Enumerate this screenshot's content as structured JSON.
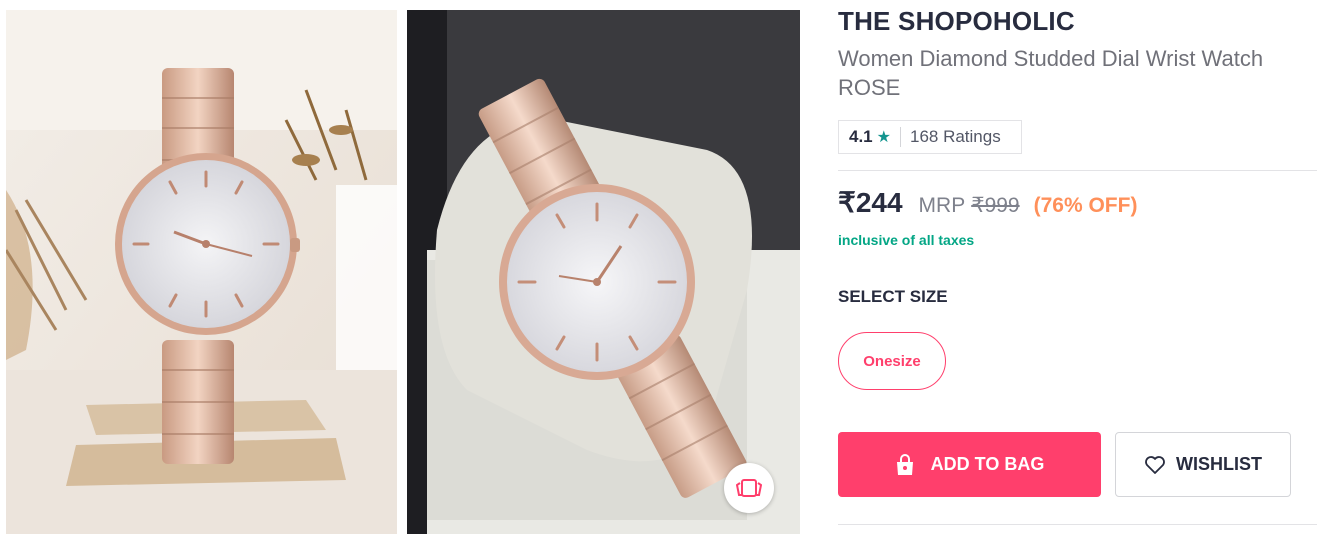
{
  "product": {
    "brand": "THE SHOPOHOLIC",
    "name": "Women Diamond Studded Dial Wrist Watch ROSE",
    "images": [
      "rose-gold-watch-front",
      "rose-gold-watch-in-box"
    ]
  },
  "rating": {
    "value": "4.1",
    "star_icon": "star-icon",
    "count": "168 Ratings"
  },
  "price": {
    "current": "₹244",
    "mrp_label": "MRP",
    "mrp": "₹999",
    "discount": "(76% OFF)",
    "tax_note": "inclusive of all taxes"
  },
  "size": {
    "heading": "SELECT SIZE",
    "options": [
      "Onesize"
    ]
  },
  "actions": {
    "add_to_bag": "ADD TO BAG",
    "add_icon": "bag-icon",
    "wishlist": "WISHLIST",
    "wishlist_icon": "heart-icon",
    "similar_icon": "view-similar-icon"
  },
  "colors": {
    "primary": "#ff3f6c",
    "text": "#282c3f",
    "discount": "#ff905a",
    "tax": "#03a685",
    "star": "#14958f"
  }
}
